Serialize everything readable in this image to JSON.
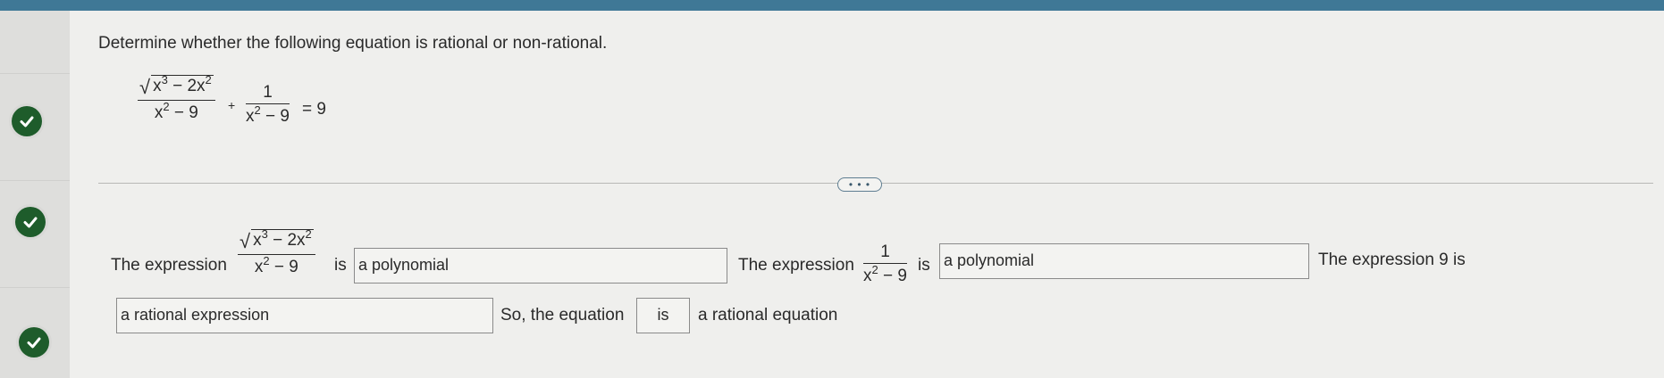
{
  "question": {
    "prompt": "Determine whether the following equation is rational or non-rational.",
    "equation": {
      "term1_num_radicand": "x3 − 2x2",
      "term1_den": "x2 − 9",
      "plus": "+",
      "term2_num": "1",
      "term2_den": "x2 − 9",
      "equals": "= 9"
    }
  },
  "expand_button": "• • •",
  "answer": {
    "lead1": "The expression",
    "expr1": {
      "radicand": "x3 − 2x2",
      "den": "x2 − 9"
    },
    "is1": "is",
    "box1": "a polynomial",
    "lead2": "The expression",
    "expr2": {
      "num": "1",
      "den": "x2 − 9"
    },
    "is2": "is",
    "box2": "a polynomial",
    "lead3": "The expression 9 is",
    "box3": "a rational expression",
    "so_text": "So, the equation",
    "box4": "is",
    "tail": "a rational equation"
  },
  "status_icons": [
    "check-icon",
    "check-icon",
    "check-icon"
  ],
  "colors": {
    "topbar": "#3f7896",
    "check_bg": "#1e5c2b",
    "background": "#efefed"
  }
}
